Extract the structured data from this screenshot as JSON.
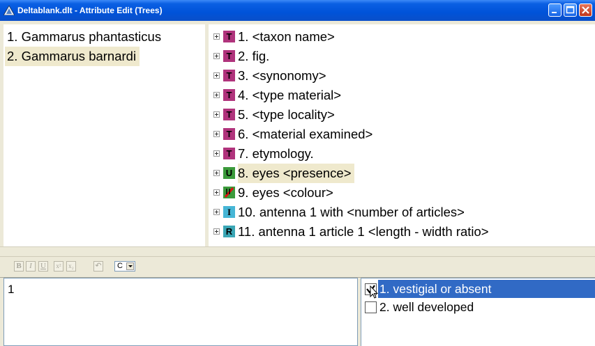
{
  "window": {
    "title": "Deltablank.dlt - Attribute Edit (Trees)",
    "buttons": [
      "minimize-icon",
      "maximize-icon",
      "close-icon"
    ],
    "titlebar_color": "#0a5fe3"
  },
  "taxa": [
    {
      "label": "1. Gammarus phantasticus",
      "selected": false
    },
    {
      "label": "2. Gammarus barnardi",
      "selected": true
    }
  ],
  "characters": [
    {
      "badge": "T",
      "badge_color": "#b0337c",
      "label": "1. <taxon name>"
    },
    {
      "badge": "T",
      "badge_color": "#b0337c",
      "label": "2. fig."
    },
    {
      "badge": "T",
      "badge_color": "#b0337c",
      "label": "3. <synonomy>"
    },
    {
      "badge": "T",
      "badge_color": "#b0337c",
      "label": "4. <type material>"
    },
    {
      "badge": "T",
      "badge_color": "#b0337c",
      "label": "5. <type locality>"
    },
    {
      "badge": "T",
      "badge_color": "#b0337c",
      "label": "6. <material examined>"
    },
    {
      "badge": "T",
      "badge_color": "#b0337c",
      "label": "7. etymology."
    },
    {
      "badge": "U",
      "badge_color": "#3b9a3b",
      "label": "8. eyes <presence>",
      "highlighted": true
    },
    {
      "badge": "",
      "badge_color": "#3b9a3b",
      "badge_icon": "crossed-ordered-icon",
      "label": "9. eyes <colour>"
    },
    {
      "badge": "I",
      "badge_color": "#46b6d6",
      "label": "10. antenna 1 with <number of articles>"
    },
    {
      "badge": "R",
      "badge_color": "#3aa6b5",
      "label": "11. antenna 1 article 1 <length - width ratio>"
    }
  ],
  "toolbar": {
    "buttons": [
      {
        "name": "bold-button",
        "text": "B"
      },
      {
        "name": "italic-button",
        "text": "I"
      },
      {
        "name": "underline-button",
        "text": "U"
      },
      {
        "name": "superscript-button",
        "text": "x²"
      },
      {
        "name": "subscript-button",
        "text": "x₂"
      },
      {
        "name": "undo-button",
        "text": "↶"
      }
    ],
    "combo_value": "C"
  },
  "editor": {
    "value": "1"
  },
  "states": [
    {
      "label": "1. vestigial or absent",
      "checked": true,
      "selected": true
    },
    {
      "label": "2. well developed",
      "checked": false,
      "selected": false
    }
  ]
}
